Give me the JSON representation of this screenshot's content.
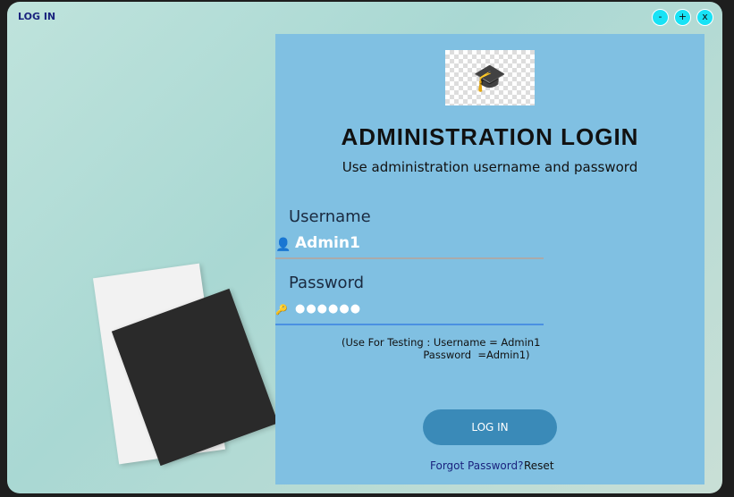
{
  "window": {
    "title": "LOG IN",
    "controls": [
      "-",
      "+",
      "x"
    ]
  },
  "login": {
    "heading": "ADMINISTRATION LOGIN",
    "subheading": "Use administration username and password",
    "username_label": "Username",
    "username_value": "Admin1",
    "password_label": "Password",
    "password_value": "●●●●●●",
    "hint_line1": "(Use For Testing : Username = Admin1",
    "hint_line2": "                         Password  =Admin1)",
    "login_button": "LOG IN",
    "forgot_link": "Forgot Password?",
    "reset_link": "Reset"
  }
}
